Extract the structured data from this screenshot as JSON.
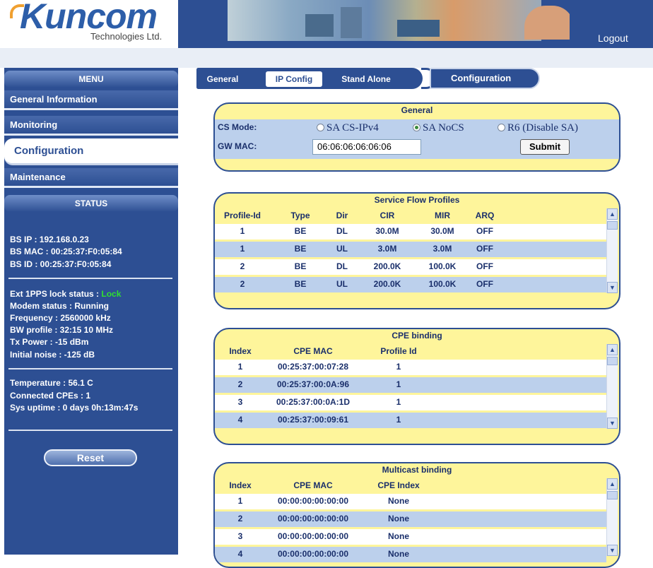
{
  "header": {
    "logo_main": "Kuncom",
    "logo_sub": "Technologies Ltd.",
    "logout": "Logout"
  },
  "menu": {
    "title": "MENU",
    "items": [
      "General Information",
      "Monitoring",
      "Configuration",
      "Maintenance"
    ],
    "active": "Configuration"
  },
  "tabs": {
    "items": [
      "General",
      "IP Config",
      "Stand Alone"
    ],
    "selected": "IP Config",
    "section": "Configuration"
  },
  "status": {
    "title": "STATUS",
    "bs_ip": "BS IP : 192.168.0.23",
    "bs_mac": "BS MAC : 00:25:37:F0:05:84",
    "bs_id": "BS ID : 00:25:37:F0:05:84",
    "pps_label": "Ext 1PPS lock status : ",
    "pps_value": "Lock",
    "modem": "Modem status : Running",
    "frequency": "Frequency : 2560000 kHz",
    "bw": "BW profile : 32:15 10 MHz",
    "tx": "Tx Power : -15 dBm",
    "noise": "Initial noise : -125 dB",
    "temp": "Temperature : 56.1 C",
    "cpes": "Connected CPEs : 1",
    "uptime": "Sys uptime : 0 days 0h:13m:47s",
    "reset": "Reset"
  },
  "general": {
    "title": "General",
    "cs_mode_label": "CS Mode:",
    "modes": [
      "SA CS-IPv4",
      "SA NoCS",
      "R6 (Disable SA)"
    ],
    "selected_mode": "SA NoCS",
    "gw_mac_label": "GW MAC:",
    "gw_mac_value": "06:06:06:06:06:06",
    "submit": "Submit"
  },
  "service_flow": {
    "title": "Service Flow Profiles",
    "headers": [
      "Profile-Id",
      "Type",
      "Dir",
      "CIR",
      "MIR",
      "ARQ"
    ],
    "rows": [
      [
        "1",
        "BE",
        "DL",
        "30.0M",
        "30.0M",
        "OFF"
      ],
      [
        "1",
        "BE",
        "UL",
        "3.0M",
        "3.0M",
        "OFF"
      ],
      [
        "2",
        "BE",
        "DL",
        "200.0K",
        "100.0K",
        "OFF"
      ],
      [
        "2",
        "BE",
        "UL",
        "200.0K",
        "100.0K",
        "OFF"
      ]
    ]
  },
  "cpe_binding": {
    "title": "CPE binding",
    "headers": [
      "Index",
      "CPE MAC",
      "Profile Id"
    ],
    "rows": [
      [
        "1",
        "00:25:37:00:07:28",
        "1"
      ],
      [
        "2",
        "00:25:37:00:0A:96",
        "1"
      ],
      [
        "3",
        "00:25:37:00:0A:1D",
        "1"
      ],
      [
        "4",
        "00:25:37:00:09:61",
        "1"
      ]
    ]
  },
  "multicast": {
    "title": "Multicast binding",
    "headers": [
      "Index",
      "CPE MAC",
      "CPE Index"
    ],
    "rows": [
      [
        "1",
        "00:00:00:00:00:00",
        "None"
      ],
      [
        "2",
        "00:00:00:00:00:00",
        "None"
      ],
      [
        "3",
        "00:00:00:00:00:00",
        "None"
      ],
      [
        "4",
        "00:00:00:00:00:00",
        "None"
      ]
    ]
  },
  "icons": {
    "scroll_up": "▲",
    "scroll_down": "▼"
  },
  "colors": {
    "brand_blue": "#2d4f93",
    "panel_yellow": "#fef59b",
    "row_alt": "#bcd0ec",
    "lock_green": "#30e030"
  }
}
